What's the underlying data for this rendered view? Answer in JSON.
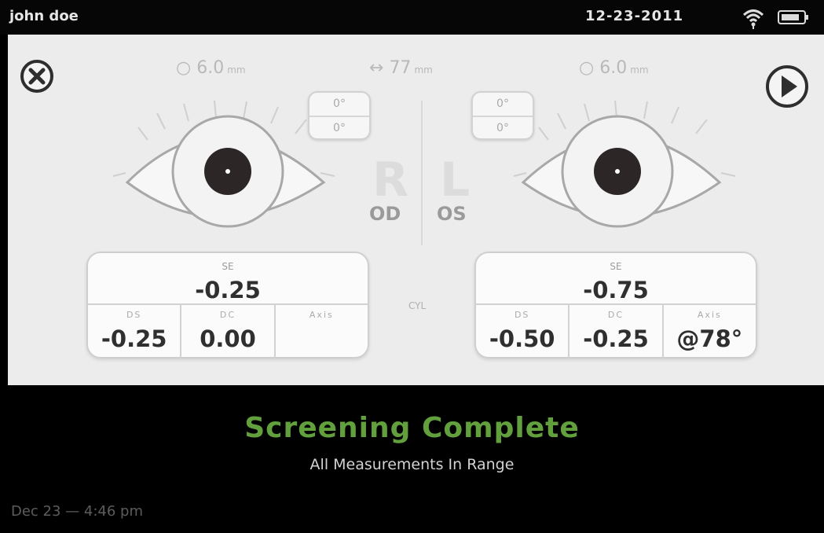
{
  "status": {
    "user": "john doe",
    "date": "12-23-2011",
    "wifi_icon": "wifi-icon",
    "battery_icon": "battery-icon"
  },
  "measure": {
    "pupil_left": "6.0",
    "pupil_right": "6.0",
    "pupil_unit": "mm",
    "pd_value": "77",
    "pd_unit": "mm"
  },
  "gaze": {
    "left": {
      "top": "0°",
      "bottom": "0°"
    },
    "right": {
      "top": "0°",
      "bottom": "0°"
    }
  },
  "labels": {
    "od": "OD",
    "os": "OS",
    "ghost_r": "R",
    "ghost_l": "L",
    "cyl": "CYL"
  },
  "od": {
    "se_caption": "SE",
    "se": "-0.25",
    "ds_caption": "DS",
    "ds": "-0.25",
    "dc_caption": "DC",
    "dc": "0.00",
    "axis_caption": "Axis",
    "axis": ""
  },
  "os": {
    "se_caption": "SE",
    "se": "-0.75",
    "ds_caption": "DS",
    "ds": "-0.50",
    "dc_caption": "DC",
    "dc": "-0.25",
    "axis_caption": "Axis",
    "axis": "@78°"
  },
  "banner": {
    "title": "Screening Complete",
    "subtitle": "All Measurements In Range",
    "timestamp": "Dec 23 — 4:46 pm",
    "title_color": "#62a03e"
  },
  "icons": {
    "close": "close-icon",
    "play": "play-icon"
  }
}
